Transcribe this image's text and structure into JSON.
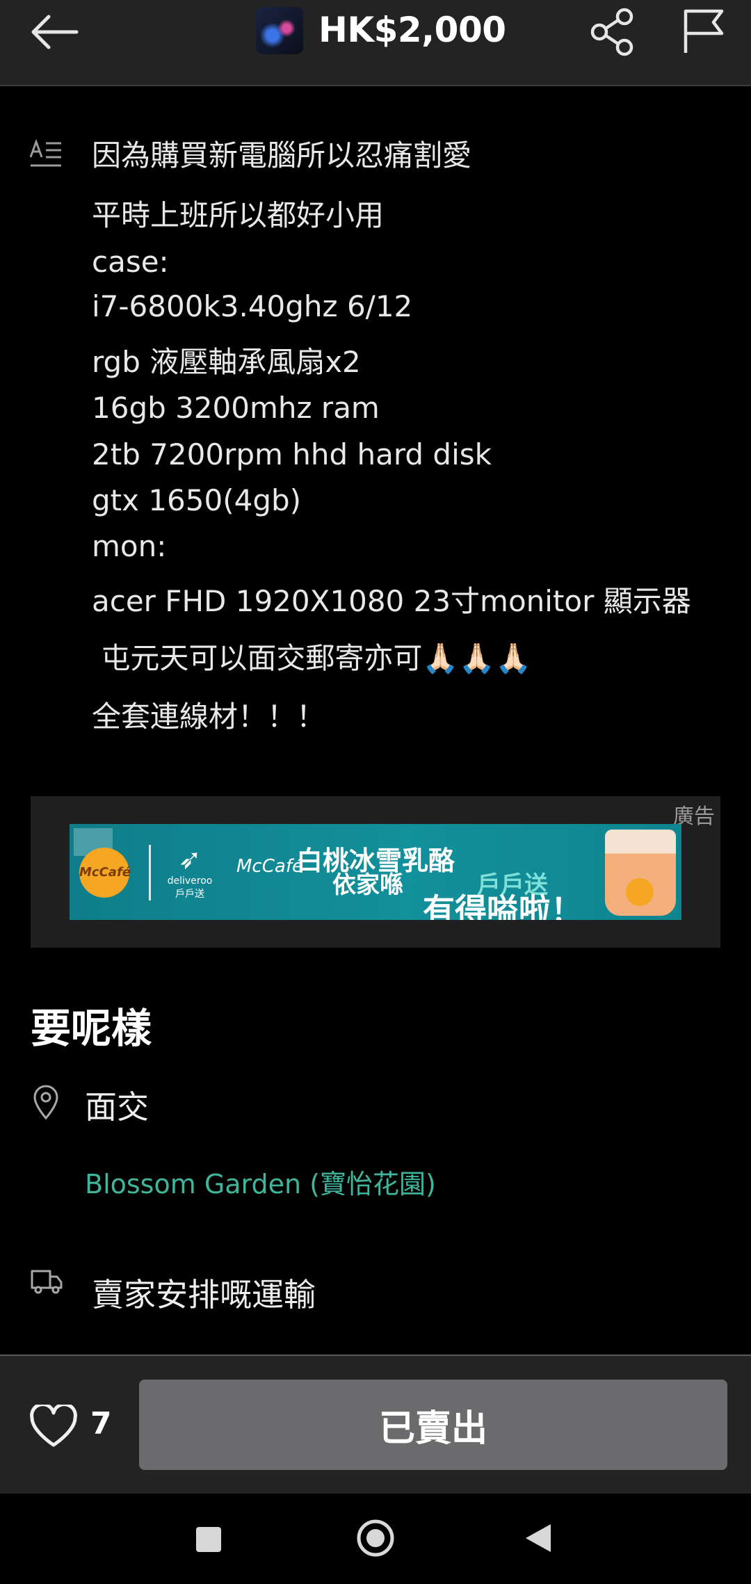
{
  "header": {
    "price": "HK$2,000",
    "icons": [
      "back-arrow-icon",
      "share-icon",
      "flag-icon"
    ]
  },
  "description": {
    "lines": [
      "因為購買新電腦所以忍痛割愛",
      "平時上班所以都好小用",
      "case:",
      "i7-6800k3.40ghz 6/12",
      "rgb 液壓軸承風扇x2",
      "16gb 3200mhz ram",
      "2tb 7200rpm hhd hard disk",
      "gtx 1650(4gb)",
      "mon:",
      "acer FHD 1920X1080 23寸monitor 顯示器",
      " 屯元天可以面交郵寄亦可🙏🏻🙏🏻🙏🏻",
      "全套連線材！！！"
    ]
  },
  "ad": {
    "label": "廣告",
    "mcafe_logo": "McCafé",
    "deliveroo_text": "deliveroo",
    "deliveroo_sub": "戶戶送",
    "mccafe_word": "McCafé",
    "headline": "白桃冰雪乳酪",
    "line2": "依家喺",
    "line2_highlight": "戶戶送",
    "line3": "有得嗌啦！"
  },
  "delivery": {
    "title": "要呢樣",
    "meetup_label": "面交",
    "location": "Blossom Garden (寶怡花園)",
    "shipping_label": "賣家安排嘅運輸"
  },
  "footer": {
    "like_count": "7",
    "status_button": "已賣出"
  },
  "colors": {
    "accent_green": "#3fb59b",
    "button_gray": "#6b6b6d",
    "bar_bg": "#232323"
  }
}
